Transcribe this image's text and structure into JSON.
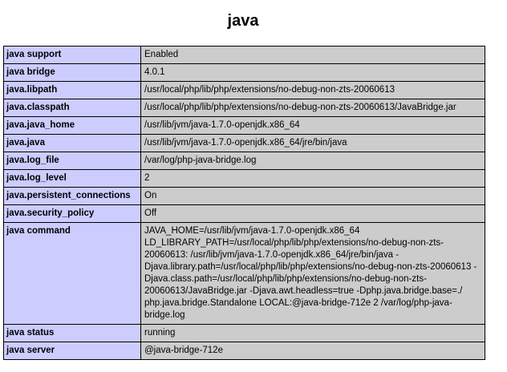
{
  "page": {
    "title": "java"
  },
  "rows": [
    {
      "key": "java support",
      "value": "Enabled"
    },
    {
      "key": "java bridge",
      "value": "4.0.1"
    },
    {
      "key": "java.libpath",
      "value": "/usr/local/php/lib/php/extensions/no-debug-non-zts-20060613"
    },
    {
      "key": "java.classpath",
      "value": "/usr/local/php/lib/php/extensions/no-debug-non-zts-20060613/JavaBridge.jar"
    },
    {
      "key": "java.java_home",
      "value": "/usr/lib/jvm/java-1.7.0-openjdk.x86_64"
    },
    {
      "key": "java.java",
      "value": "/usr/lib/jvm/java-1.7.0-openjdk.x86_64/jre/bin/java"
    },
    {
      "key": "java.log_file",
      "value": "/var/log/php-java-bridge.log"
    },
    {
      "key": "java.log_level",
      "value": "2"
    },
    {
      "key": "java.persistent_connections",
      "value": "On"
    },
    {
      "key": "java.security_policy",
      "value": "Off"
    },
    {
      "key": "java command",
      "value": "JAVA_HOME=/usr/lib/jvm/java-1.7.0-openjdk.x86_64 LD_LIBRARY_PATH=/usr/local/php/lib/php/extensions/no-debug-non-zts-20060613: /usr/lib/jvm/java-1.7.0-openjdk.x86_64/jre/bin/java -Djava.library.path=/usr/local/php/lib/php/extensions/no-debug-non-zts-20060613 -Djava.class.path=/usr/local/php/lib/php/extensions/no-debug-non-zts-20060613/JavaBridge.jar -Djava.awt.headless=true -Dphp.java.bridge.base=./ php.java.bridge.Standalone LOCAL:@java-bridge-712e 2 /var/log/php-java-bridge.log"
    },
    {
      "key": "java status",
      "value": "running"
    },
    {
      "key": "java server",
      "value": "@java-bridge-712e"
    }
  ]
}
